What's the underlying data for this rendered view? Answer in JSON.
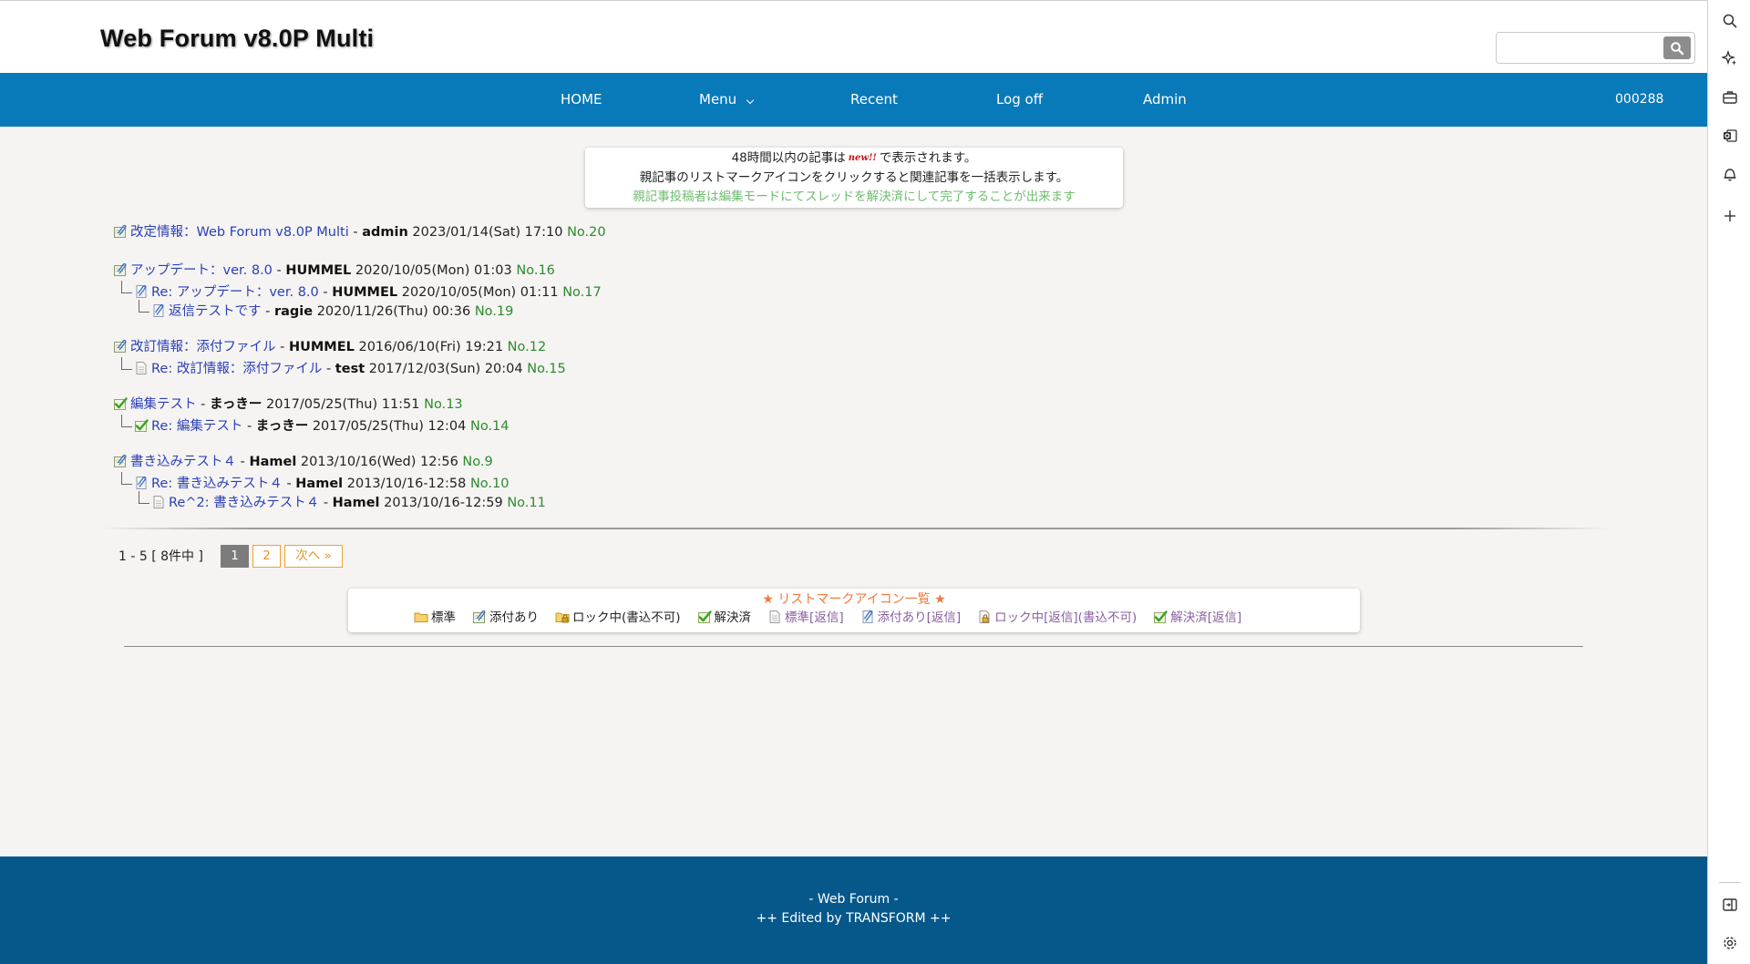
{
  "header": {
    "site_title": "Web Forum v8.0P Multi",
    "search_placeholder": "",
    "search_value": ""
  },
  "nav": {
    "items": [
      "HOME",
      "Menu",
      "Recent",
      "Log off",
      "Admin"
    ],
    "counter": "000288"
  },
  "notice": {
    "line1_before": "48時間以内の記事は",
    "new_badge": "new!!",
    "line1_after": "で表示されます。",
    "line2": "親記事のリストマークアイコンをクリックすると関連記事を一括表示します。",
    "line3": "親記事投稿者は編集モードにてスレッドを解決済にして完了することが出来ます"
  },
  "threads": [
    {
      "level": 0,
      "icon": "attach-icon",
      "title": "改定情報：Web Forum v8.0P Multi",
      "author": "admin",
      "date": "2023/01/14(Sat) 17:10",
      "no": "No.20"
    },
    {
      "level": 0,
      "icon": "attach-icon",
      "title": "アップデート：ver. 8.0",
      "author": "HUMMEL",
      "date": "2020/10/05(Mon) 01:03",
      "no": "No.16"
    },
    {
      "level": 1,
      "icon": "attach-reply-icon",
      "title": "Re: アップデート：ver. 8.0",
      "author": "HUMMEL",
      "date": "2020/10/05(Mon) 01:11",
      "no": "No.17"
    },
    {
      "level": 2,
      "icon": "attach-reply-icon",
      "title": "返信テストです",
      "author": "ragie",
      "date": "2020/11/26(Thu) 00:36",
      "no": "No.19"
    },
    {
      "level": 0,
      "icon": "attach-icon",
      "title": "改訂情報：添付ファイル",
      "author": "HUMMEL",
      "date": "2016/06/10(Fri) 19:21",
      "no": "No.12"
    },
    {
      "level": 1,
      "icon": "document-icon",
      "title": "Re: 改訂情報：添付ファイル",
      "author": "test",
      "date": "2017/12/03(Sun) 20:04",
      "no": "No.15"
    },
    {
      "level": 0,
      "icon": "check-icon",
      "title": "編集テスト",
      "author": "まっきー",
      "date": "2017/05/25(Thu) 11:51",
      "no": "No.13"
    },
    {
      "level": 1,
      "icon": "check-icon",
      "title": "Re: 編集テスト",
      "author": "まっきー",
      "date": "2017/05/25(Thu) 12:04",
      "no": "No.14"
    },
    {
      "level": 0,
      "icon": "attach-icon",
      "title": "書き込みテスト４",
      "author": "Hamel",
      "date": "2013/10/16(Wed) 12:56",
      "no": "No.9"
    },
    {
      "level": 1,
      "icon": "attach-reply-icon",
      "title": "Re: 書き込みテスト４",
      "author": "Hamel",
      "date": "2013/10/16-12:58",
      "no": "No.10"
    },
    {
      "level": 2,
      "icon": "document-icon",
      "title": "Re^2: 書き込みテスト４",
      "author": "Hamel",
      "date": "2013/10/16-12:59",
      "no": "No.11"
    }
  ],
  "pagination": {
    "range": "1 - 5 [ 8件中 ]",
    "pages": [
      "1",
      "2"
    ],
    "current": "1",
    "next": "次へ »"
  },
  "legend": {
    "title": "★ リストマークアイコン一覧 ★",
    "items": [
      {
        "icon": "folder-icon",
        "label": "標準",
        "style": "dark"
      },
      {
        "icon": "attach-icon",
        "label": "添付あり",
        "style": "dark"
      },
      {
        "icon": "lock-folder-icon",
        "label": "ロック中(書込不可)",
        "style": "dark"
      },
      {
        "icon": "check-icon",
        "label": "解決済",
        "style": "dark"
      },
      {
        "icon": "document-icon",
        "label": "標準[返信]",
        "style": "purple"
      },
      {
        "icon": "attach-reply-icon",
        "label": "添付あり[返信]",
        "style": "purple"
      },
      {
        "icon": "lock-doc-icon",
        "label": "ロック中[返信](書込不可)",
        "style": "purple"
      },
      {
        "icon": "check-icon",
        "label": "解決済[返信]",
        "style": "purple"
      }
    ]
  },
  "footer": {
    "line1": "- Web Forum -",
    "line2": "++ Edited by TRANSFORM ++"
  },
  "sidebar": {
    "icons": [
      "search-icon",
      "sparkle-icon",
      "toolbox-icon",
      "outlook-icon",
      "bell-icon",
      "plus-icon",
      "split-screen-icon",
      "settings-icon"
    ]
  },
  "colors": {
    "nav": "#0879b9",
    "footer": "#06588a",
    "link": "#2a3fb8",
    "post_no": "#2d8a2d",
    "notice_green": "#6fbd6f",
    "legend_title": "#f07a3a",
    "page_accent": "#e8932a"
  }
}
